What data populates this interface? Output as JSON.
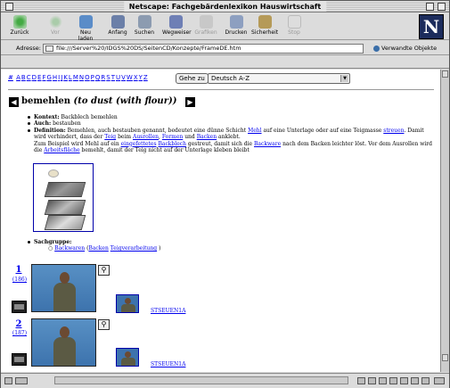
{
  "window": {
    "title": "Netscape: Fachgebärdenlexikon Hauswirtschaft"
  },
  "toolbar": {
    "buttons": [
      {
        "label": "Zurück",
        "icon": "back-icon",
        "enabled": true
      },
      {
        "label": "Vor",
        "icon": "forward-icon",
        "enabled": false
      },
      {
        "label": "Neu laden",
        "icon": "reload-icon",
        "enabled": true
      },
      {
        "label": "Anfang",
        "icon": "home-icon",
        "enabled": true
      },
      {
        "label": "Suchen",
        "icon": "search-icon",
        "enabled": true
      },
      {
        "label": "Wegweiser",
        "icon": "guide-icon",
        "enabled": true
      },
      {
        "label": "Grafiken",
        "icon": "images-icon",
        "enabled": false
      },
      {
        "label": "Drucken",
        "icon": "print-icon",
        "enabled": true
      },
      {
        "label": "Sicherheit",
        "icon": "security-icon",
        "enabled": true
      },
      {
        "label": "Stop",
        "icon": "stop-icon",
        "enabled": false
      }
    ],
    "logo": "N"
  },
  "location": {
    "label": "Adresse:",
    "url": "file:///Server%20/IDGS%20DS/SeitenCD/Konzepte/FrameDE.htm",
    "related": "Verwandte Objekte"
  },
  "navbar": {
    "hash": "#",
    "letters": [
      "A",
      "B",
      "C",
      "D",
      "E",
      "F",
      "G",
      "H",
      "I",
      "J",
      "K",
      "L",
      "M",
      "N",
      "O",
      "P",
      "Q",
      "R",
      "S",
      "T",
      "U",
      "V",
      "W",
      "X",
      "Y",
      "Z"
    ],
    "goto_label": "Gehe zu",
    "select_value": "Deutsch A-Z"
  },
  "entry": {
    "headword": "bemehlen",
    "translation": "(to dust (with flour))",
    "kontext_label": "Kontext:",
    "kontext": "Backblech bemehlen",
    "auch_label": "Auch:",
    "auch": "bestauben",
    "def_label": "Definition:",
    "def_1": "Bemehlen, auch bestauben genannt, bedeutet eine dünne Schicht",
    "def_mehl": "Mehl",
    "def_2": "auf eine Unterlage oder auf eine Teigmasse",
    "def_streuen": "streuen",
    "def_3": ". Damit wird verhindert, dass der",
    "def_teig": "Teig",
    "def_4": "beim",
    "def_ausrollen": "Ausrollen",
    "def_5": ",",
    "def_formen": "Formen",
    "def_6": "und",
    "def_backen": "Backen",
    "def_7": "anklebt.",
    "def_8": "Zum Beispiel wird Mehl auf ein",
    "def_eingefettet": "eingefettetes",
    "def_backblech": "Backblech",
    "def_9": "gestreut, damit sich die",
    "def_backware": "Backware",
    "def_10": "nach dem Backen leichter löst. Vor dem Ausrollen wird die",
    "def_arbeitsflaeche": "Arbeitsfläche",
    "def_11": "bemehlt, damit der Teig nicht auf der Unterlage kleben bleibt",
    "sachgruppe_label": "Sachgruppe:",
    "sach_1": "Backwaren",
    "sach_2": "(",
    "sach_3": "Backen",
    "sach_4": "Teigverarbeitung",
    "sach_5": ")"
  },
  "videos": [
    {
      "number": "1",
      "sub": "(186)",
      "link": "STSEUEN1A"
    },
    {
      "number": "2",
      "sub": "(187)",
      "link": "STSEUEN1A"
    }
  ]
}
